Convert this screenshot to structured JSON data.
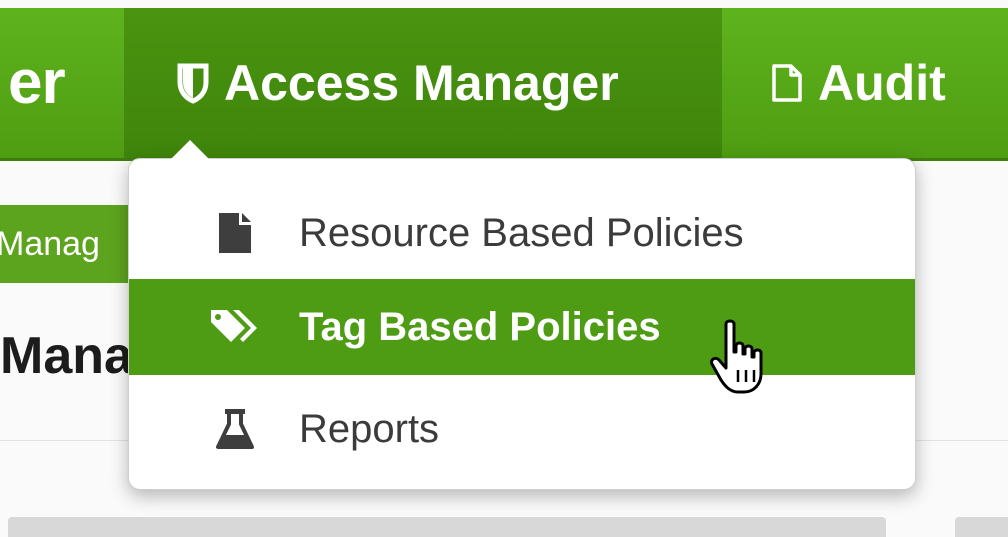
{
  "navbar": {
    "brand_fragment": "er",
    "active_item": {
      "label": "Access Manager",
      "icon": "shield-icon"
    },
    "audit_item": {
      "label": "Audit",
      "icon": "document-icon"
    }
  },
  "background": {
    "badge_fragment": "Manag",
    "heading_fragment": "Mana"
  },
  "dropdown": {
    "items": [
      {
        "label": "Resource Based Policies",
        "icon": "file-icon"
      },
      {
        "label": "Tag Based Policies",
        "icon": "tags-icon",
        "highlighted": true
      },
      {
        "label": "Reports",
        "icon": "flask-icon"
      }
    ]
  },
  "colors": {
    "nav_green": "#5eb31d",
    "nav_active_green": "#3f850b",
    "menu_highlight": "#4e9b14"
  }
}
